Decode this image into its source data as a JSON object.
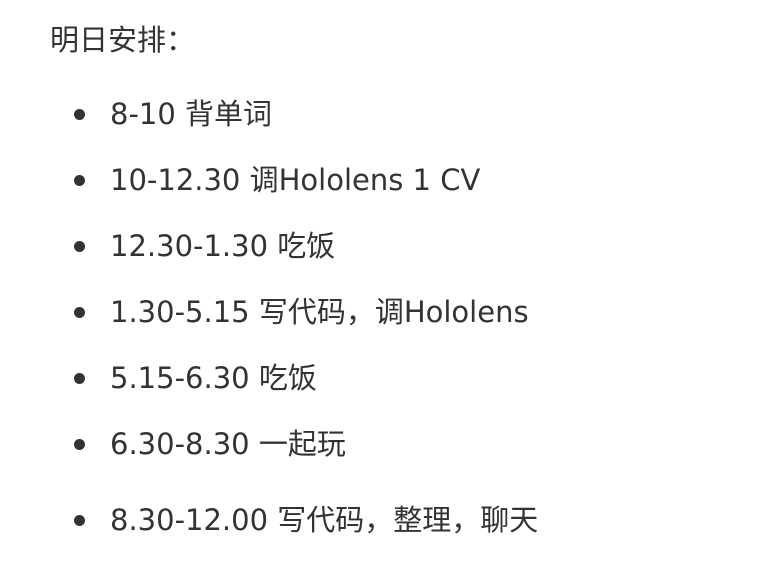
{
  "heading": "明日安排：",
  "items": [
    "8-10 背单词",
    "10-12.30 调Hololens 1 CV",
    "12.30-1.30 吃饭",
    "1.30-5.15 写代码，调Hololens",
    "5.15-6.30 吃饭",
    "6.30-8.30 一起玩",
    "8.30-12.00 写代码，整理，聊天"
  ]
}
